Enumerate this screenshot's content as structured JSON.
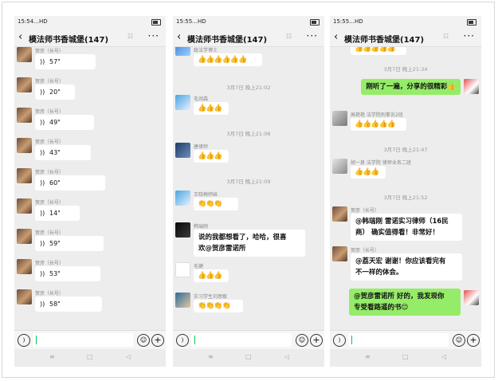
{
  "chat_title": "模法师书香城堡(147)",
  "status_times": [
    "15:54",
    "15:55",
    "15:55"
  ],
  "status_signal": "…HD",
  "icons": {
    "back": "‹",
    "more": "···",
    "mute": "☷",
    "voice": "))",
    "smile": "☺",
    "plus": "+",
    "mic": ")"
  },
  "nav": {
    "menu": "≡",
    "home": "□",
    "back": "◁"
  },
  "phone1": {
    "sender": "贺彦（长号）",
    "voices": [
      "57\"",
      "20\"",
      "49\"",
      "43\"",
      "60\"",
      "14\"",
      "59\"",
      "53\"",
      "58\""
    ]
  },
  "phone2": {
    "top_name": "政法学博士",
    "thumbs6": "👍👍👍👍👍👍",
    "ts1": "3月7日 晚上21:02",
    "n1": "毛润森",
    "thumbs3": "👍👍👍",
    "ts2": "3月7日 晚上21:06",
    "n2": "唐律师",
    "ts3": "3月7日 晚上21:09",
    "n3": "王晓梅师妹",
    "claps3": "👏👏👏",
    "n4": "韩瑞刚",
    "msg4a": "说的我都想看了，哈哈，很喜",
    "msg4b": "欢@贺彦雷诺所",
    "n5": "毛健",
    "n6": "实习学生刘思敏",
    "claps4": "👏👏👏👏"
  },
  "phone3": {
    "top_thumbs": "👍👍👍👍👍",
    "ts1": "3月7日 晚上21:34",
    "me1": "刚听了一遍，分享的很精彩👍",
    "n1": "高艳艳 法学院刑事诉2班",
    "thumbs5": "👍👍👍👍👍",
    "ts2": "3月7日 晚上21:47",
    "n2": "胡一泉 法学院 律师业务二班",
    "thumbs3": "👍👍👍",
    "ts3": "3月7日 晚上21:52",
    "n3": "贺彦（长号）",
    "m3a": "@韩瑞刚 雷诺实习律师（16民",
    "m3b": "商） 确实值得看！非常好！",
    "n4": "贺彦（长号）",
    "m4a": "@荔天宏 谢谢！你应该看完有",
    "m4b": "不一样的体会。",
    "me2a": "@贺彦雷诺所 好的，我发现你",
    "me2b": "专受看路遥的书😊"
  }
}
